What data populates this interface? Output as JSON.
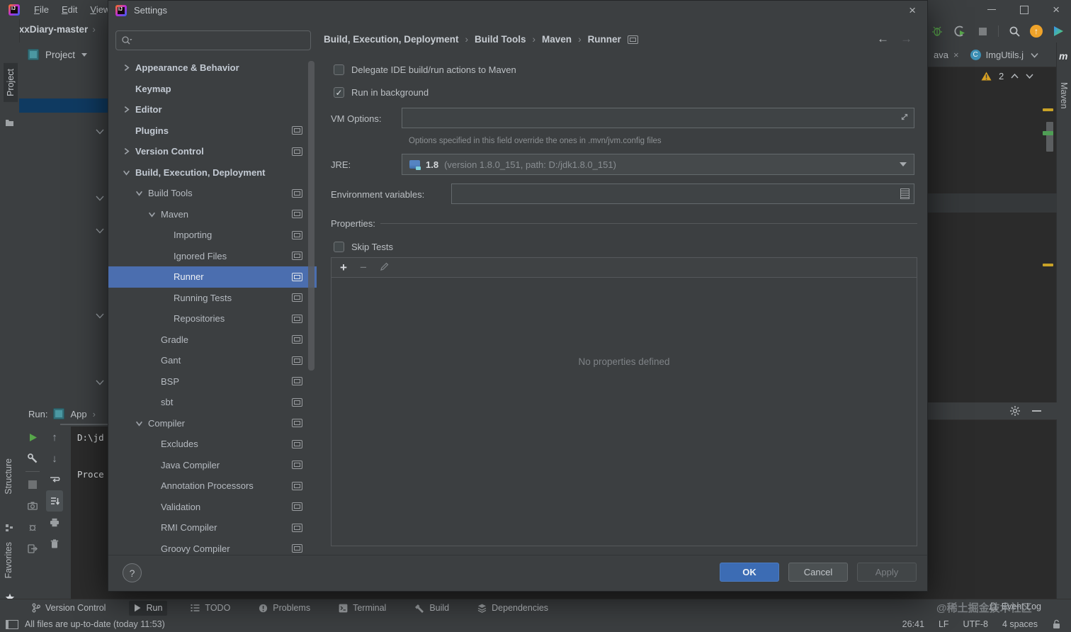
{
  "window": {
    "menus": [
      "File",
      "Edit",
      "View"
    ],
    "project_breadcrumb": "WxxDiary-master",
    "breadcrumb_sep": "›",
    "editor_tabs": {
      "partial_tab": "ava",
      "partial_tab_close": "×",
      "active_tab": "ImgUtils.j"
    },
    "maven_stripe": {
      "logo": "m",
      "label": "Maven"
    },
    "inspections": {
      "warning_count": "2"
    },
    "left_stripe": {
      "project": "Project",
      "structure": "Structure",
      "favorites": "Favorites",
      "more": "»"
    },
    "project_panel": {
      "title": "Project"
    },
    "run_panel": {
      "label": "Run:",
      "config_name": "App",
      "chevron": "›",
      "console_line1": "D:\\jd",
      "console_line2": "Proce"
    },
    "bottom_buttons": [
      {
        "icon": "branch",
        "label": "Version Control",
        "active": false
      },
      {
        "icon": "play",
        "label": "Run",
        "active": true
      },
      {
        "icon": "todo",
        "label": "TODO",
        "active": false
      },
      {
        "icon": "problems",
        "label": "Problems",
        "active": false
      },
      {
        "icon": "terminal",
        "label": "Terminal",
        "active": false
      },
      {
        "icon": "build",
        "label": "Build",
        "active": false
      },
      {
        "icon": "dependencies",
        "label": "Dependencies",
        "active": false
      }
    ],
    "event_log": "Event Log",
    "status_bar": {
      "left_text": "All files are up-to-date (today 11:53)",
      "items": [
        {
          "name": "position",
          "value": "26:41"
        },
        {
          "name": "line-separator",
          "value": "LF"
        },
        {
          "name": "encoding",
          "value": "UTF-8"
        },
        {
          "name": "indent",
          "value": "4 spaces"
        }
      ]
    },
    "watermark": "@稀土掘金技术社区"
  },
  "dialog": {
    "title": "Settings",
    "search_value": "",
    "tree": [
      {
        "label": "Appearance & Behavior",
        "level": 0,
        "chevron": "right",
        "bold": true,
        "icon": false,
        "selected": false
      },
      {
        "label": "Keymap",
        "level": 0,
        "chevron": null,
        "bold": true,
        "icon": false,
        "selected": false
      },
      {
        "label": "Editor",
        "level": 0,
        "chevron": "right",
        "bold": true,
        "icon": false,
        "selected": false
      },
      {
        "label": "Plugins",
        "level": 0,
        "chevron": null,
        "bold": true,
        "icon": true,
        "selected": false
      },
      {
        "label": "Version Control",
        "level": 0,
        "chevron": "right",
        "bold": true,
        "icon": true,
        "selected": false
      },
      {
        "label": "Build, Execution, Deployment",
        "level": 0,
        "chevron": "down",
        "bold": true,
        "icon": false,
        "selected": false
      },
      {
        "label": "Build Tools",
        "level": 1,
        "chevron": "down",
        "bold": false,
        "icon": true,
        "selected": false
      },
      {
        "label": "Maven",
        "level": 2,
        "chevron": "down",
        "bold": false,
        "icon": true,
        "selected": false
      },
      {
        "label": "Importing",
        "level": 3,
        "chevron": null,
        "bold": false,
        "icon": true,
        "selected": false
      },
      {
        "label": "Ignored Files",
        "level": 3,
        "chevron": null,
        "bold": false,
        "icon": true,
        "selected": false
      },
      {
        "label": "Runner",
        "level": 3,
        "chevron": null,
        "bold": false,
        "icon": true,
        "selected": true
      },
      {
        "label": "Running Tests",
        "level": 3,
        "chevron": null,
        "bold": false,
        "icon": true,
        "selected": false
      },
      {
        "label": "Repositories",
        "level": 3,
        "chevron": null,
        "bold": false,
        "icon": true,
        "selected": false
      },
      {
        "label": "Gradle",
        "level": 2,
        "chevron": null,
        "bold": false,
        "icon": true,
        "selected": false
      },
      {
        "label": "Gant",
        "level": 2,
        "chevron": null,
        "bold": false,
        "icon": true,
        "selected": false
      },
      {
        "label": "BSP",
        "level": 2,
        "chevron": null,
        "bold": false,
        "icon": true,
        "selected": false
      },
      {
        "label": "sbt",
        "level": 2,
        "chevron": null,
        "bold": false,
        "icon": true,
        "selected": false
      },
      {
        "label": "Compiler",
        "level": 1,
        "chevron": "down",
        "bold": false,
        "icon": true,
        "selected": false
      },
      {
        "label": "Excludes",
        "level": 2,
        "chevron": null,
        "bold": false,
        "icon": true,
        "selected": false
      },
      {
        "label": "Java Compiler",
        "level": 2,
        "chevron": null,
        "bold": false,
        "icon": true,
        "selected": false
      },
      {
        "label": "Annotation Processors",
        "level": 2,
        "chevron": null,
        "bold": false,
        "icon": true,
        "selected": false
      },
      {
        "label": "Validation",
        "level": 2,
        "chevron": null,
        "bold": false,
        "icon": true,
        "selected": false
      },
      {
        "label": "RMI Compiler",
        "level": 2,
        "chevron": null,
        "bold": false,
        "icon": true,
        "selected": false
      },
      {
        "label": "Groovy Compiler",
        "level": 2,
        "chevron": null,
        "bold": false,
        "icon": true,
        "selected": false
      }
    ],
    "breadcrumb": [
      "Build, Execution, Deployment",
      "Build Tools",
      "Maven",
      "Runner"
    ],
    "form": {
      "delegate_label": "Delegate IDE build/run actions to Maven",
      "delegate_checked": false,
      "run_bg_label": "Run in background",
      "run_bg_checked": true,
      "vm_options_label": "VM Options:",
      "vm_options_value": "",
      "vm_options_hint": "Options specified in this field override the ones in .mvn/jvm.config files",
      "jre_label": "JRE:",
      "jre_value_main": "1.8",
      "jre_value_detail": "(version 1.8.0_151, path: D:/jdk1.8.0_151)",
      "env_label": "Environment variables:",
      "env_value": "",
      "properties_label": "Properties:",
      "skip_tests_label": "Skip Tests",
      "skip_tests_checked": false,
      "empty_text": "No properties defined"
    },
    "footer": {
      "help": "?",
      "ok": "OK",
      "cancel": "Cancel",
      "apply": "Apply"
    }
  },
  "colors": {
    "window_bg": "#3c3f41",
    "editor_bg": "#2b2b2b",
    "selection_blue": "#4b6eaf",
    "unfocused_selection": "#0f3a61",
    "ok_button": "#3c6cb4",
    "warning_yellow": "#d7a021",
    "update_orange": "#efa32a",
    "run_green": "#4fa55b"
  }
}
